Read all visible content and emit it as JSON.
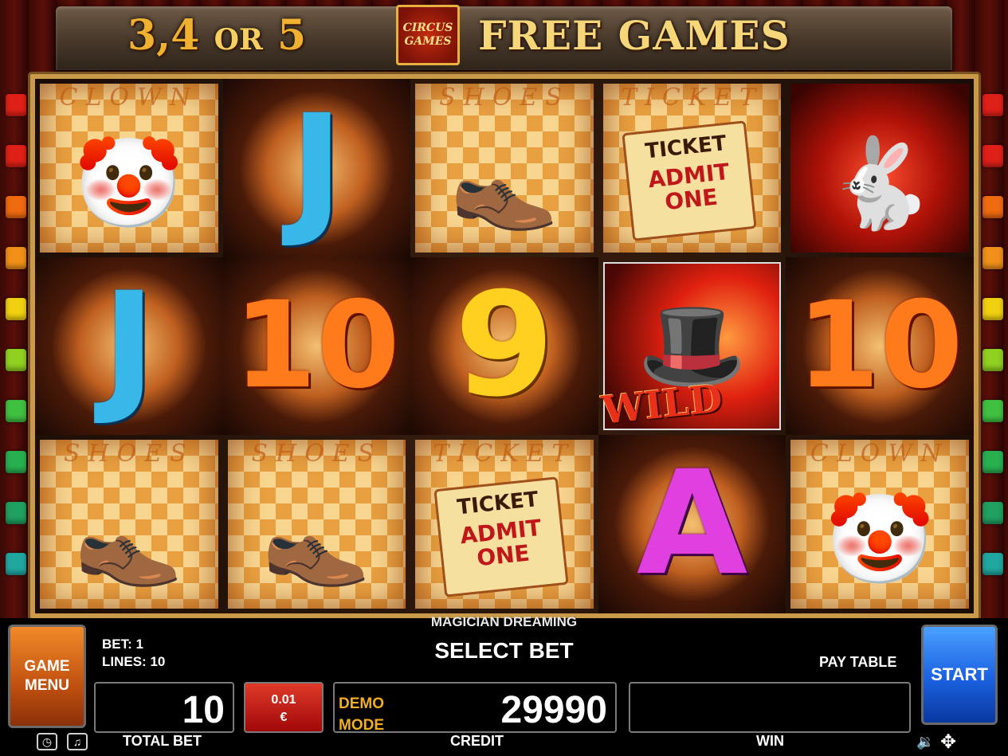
{
  "banner": {
    "left_text_a": "3,4",
    "left_text_b": "OR",
    "left_text_c": "5",
    "logo_line1": "CIRCUS",
    "logo_line2": "GAMES",
    "right_text": "FREE GAMES"
  },
  "side_lights": [
    "#e02018",
    "#e02018",
    "#f06a10",
    "#f09018",
    "#f0d010",
    "#90d020",
    "#40c040",
    "#28b050",
    "#20a060",
    "#20a8a0"
  ],
  "reels": [
    [
      {
        "type": "card",
        "title": "CLOWN",
        "glyph": "🤡",
        "name": "clown-symbol"
      },
      {
        "type": "glyph",
        "glyph": "J",
        "style": "glyph-J",
        "name": "j-symbol"
      },
      {
        "type": "card",
        "title": "SHOES",
        "glyph": "👞",
        "name": "shoes-symbol"
      },
      {
        "type": "ticket",
        "title": "TICKET",
        "ticket_a": "TICKET",
        "ticket_b": "ADMIT ONE",
        "name": "ticket-symbol"
      },
      {
        "type": "red",
        "glyph": "🐇",
        "name": "rabbit-symbol"
      }
    ],
    [
      {
        "type": "glyph",
        "glyph": "J",
        "style": "glyph-J",
        "name": "j-symbol"
      },
      {
        "type": "glyph",
        "glyph": "10",
        "style": "glyph-10",
        "name": "ten-symbol"
      },
      {
        "type": "glyph",
        "glyph": "9",
        "style": "glyph-9",
        "name": "nine-symbol"
      },
      {
        "type": "wild",
        "glyph": "🎩",
        "wild": "WILD",
        "name": "wild-magician-symbol"
      },
      {
        "type": "glyph",
        "glyph": "10",
        "style": "glyph-10",
        "name": "ten-symbol"
      }
    ],
    [
      {
        "type": "card",
        "title": "SHOES",
        "glyph": "👞",
        "name": "shoes-symbol"
      },
      {
        "type": "card",
        "title": "SHOES",
        "glyph": "👞",
        "name": "shoes-symbol"
      },
      {
        "type": "ticket",
        "title": "TICKET",
        "ticket_a": "TICKET",
        "ticket_b": "ADMIT ONE",
        "name": "ticket-symbol"
      },
      {
        "type": "glyph",
        "glyph": "A",
        "style": "glyph-A",
        "name": "a-symbol"
      },
      {
        "type": "card",
        "title": "CLOWN",
        "glyph": "🤡",
        "name": "clown-symbol"
      }
    ]
  ],
  "panel": {
    "game_title": "MAGICIAN DREAMING",
    "select_bet": "SELECT BET",
    "bet": "BET: 1",
    "lines": "LINES: 10",
    "pay_table": "PAY TABLE",
    "game_menu": "GAME MENU",
    "start": "START",
    "total_bet_value": "10",
    "total_bet_label": "TOTAL BET",
    "denom_value": "0.01",
    "denom_currency": "€",
    "demo_line1": "DEMO",
    "demo_line2": "MODE",
    "credit_value": "29990",
    "credit_label": "CREDIT",
    "win_value": "",
    "win_label": "WIN"
  },
  "icons": {
    "clock": "clock-icon",
    "music": "music-icon",
    "speaker": "speaker-icon",
    "fullscreen": "fullscreen-icon"
  }
}
